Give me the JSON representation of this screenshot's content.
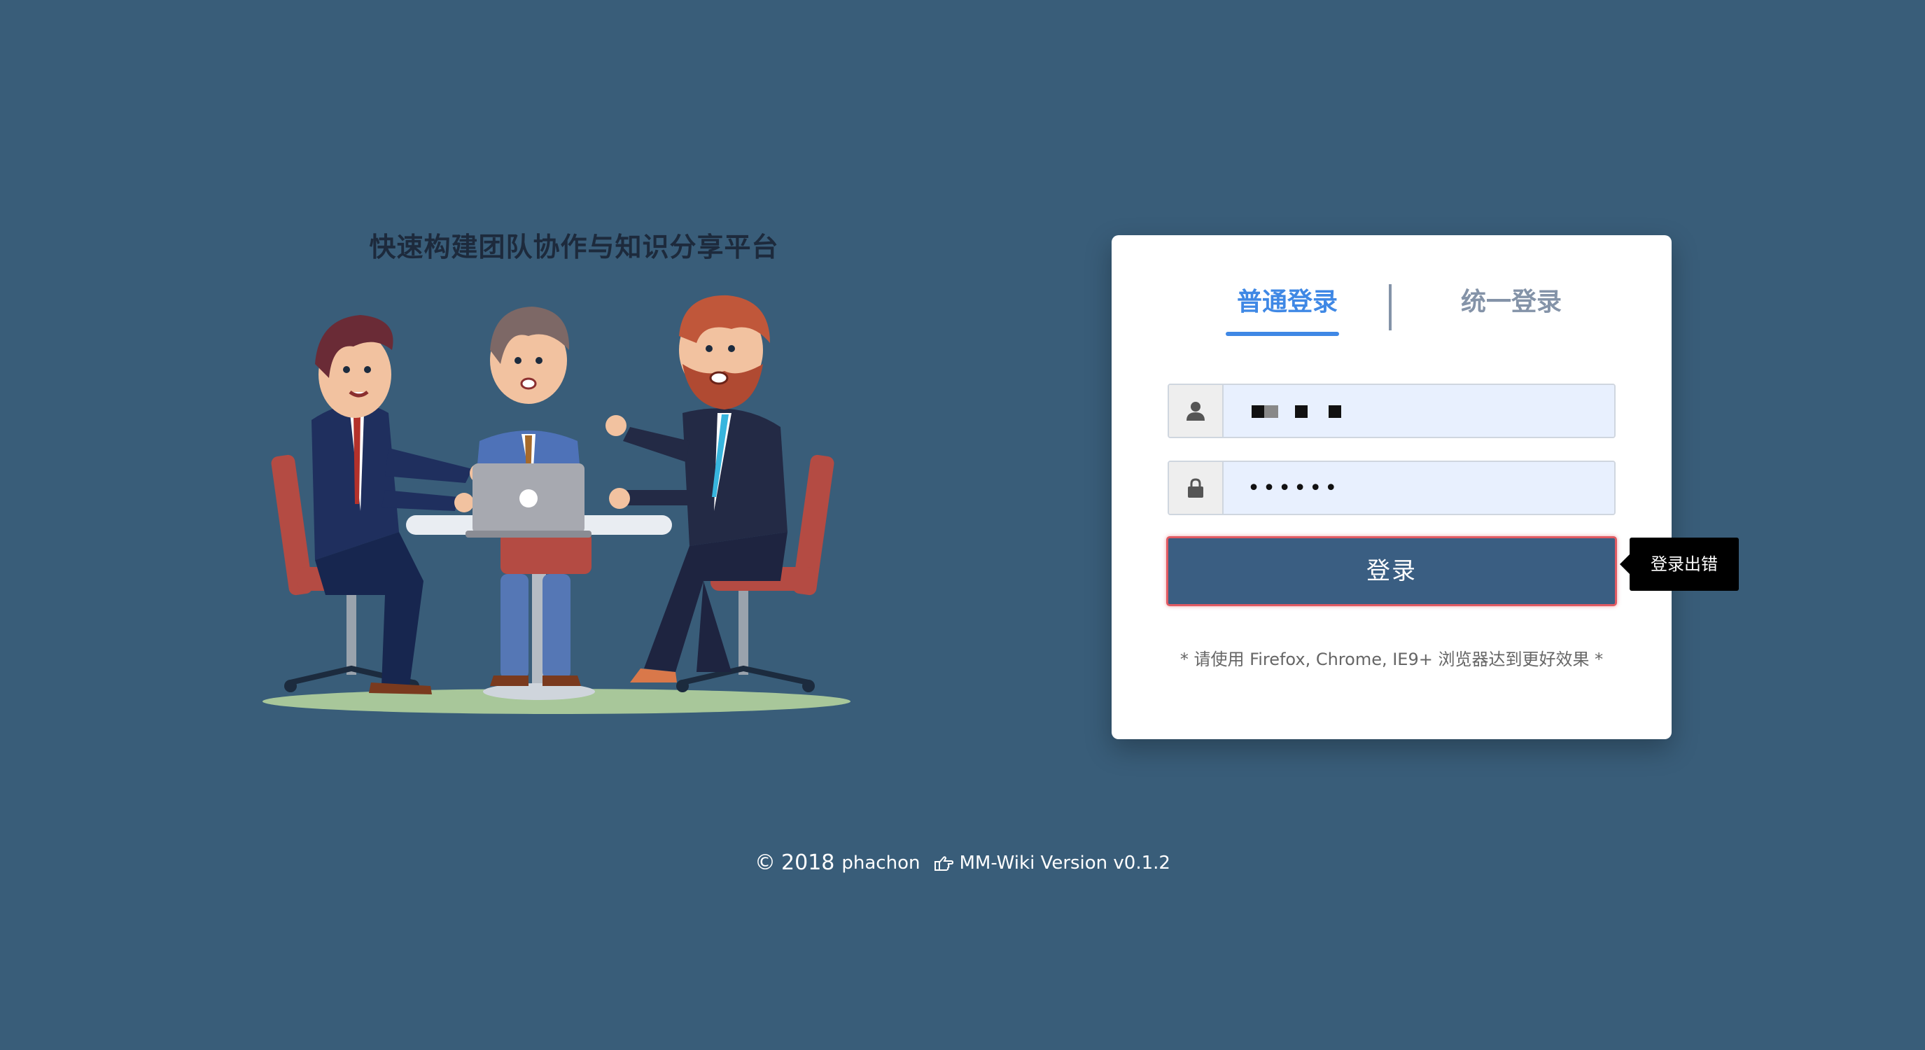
{
  "hero": {
    "title": "快速构建团队协作与知识分享平台"
  },
  "login": {
    "tabs": [
      {
        "label": "普通登录",
        "active": true
      },
      {
        "label": "统一登录",
        "active": false
      }
    ],
    "username": {
      "icon": "user-icon"
    },
    "password": {
      "icon": "lock-icon",
      "value": "••••••"
    },
    "submit_label": "登录",
    "hint": "* 请使用 Firefox, Chrome, IE9+ 浏览器达到更好效果 *"
  },
  "tooltip": {
    "text": "登录出错"
  },
  "footer": {
    "copyright_symbol": "©",
    "year": "2018",
    "author": "phachon",
    "product": "MM-Wiki Version v0.1.2",
    "hand_icon": "pointing-hand-icon"
  },
  "colors": {
    "background": "#395d79",
    "accent": "#3f88e5",
    "button": "#3a5e82",
    "error_border": "#e05a62"
  }
}
